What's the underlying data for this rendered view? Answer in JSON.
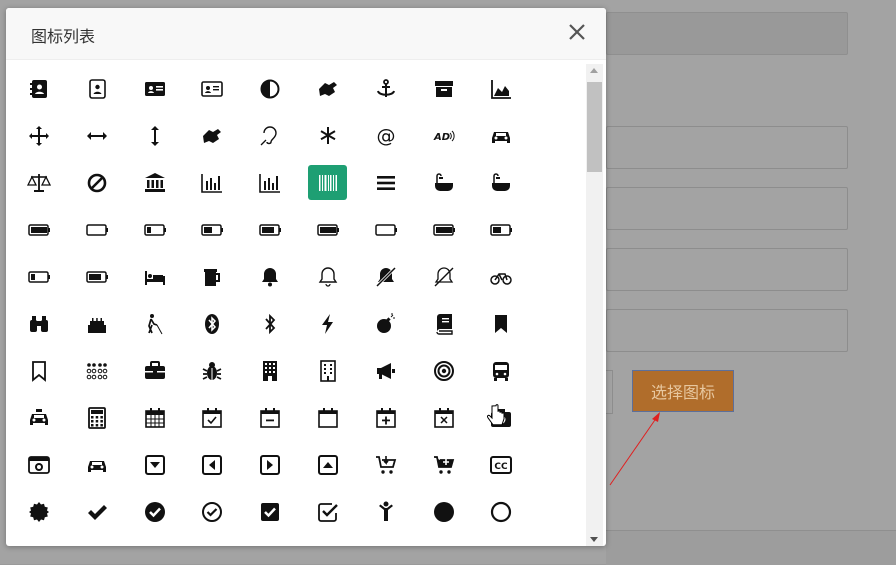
{
  "modal": {
    "title": "图标列表",
    "selected_index": 23
  },
  "icons": [
    "address-book",
    "address-book-o",
    "address-card",
    "address-card-o",
    "adjust",
    "american-sign-language-interpreting",
    "anchor",
    "archive",
    "area-chart",
    "arrows",
    "arrows-h",
    "arrows-v",
    "asl-interpreting",
    "assistive-listening-systems",
    "asterisk",
    "at",
    "audio-description",
    "automobile",
    "balance-scale",
    "ban",
    "bank",
    "bar-chart",
    "bar-chart-o",
    "barcode",
    "bars",
    "bath",
    "bathtub",
    "battery",
    "battery-0",
    "battery-1",
    "battery-2",
    "battery-3",
    "battery-4",
    "battery-empty",
    "battery-full",
    "battery-half",
    "battery-quarter",
    "battery-three-quarters",
    "bed",
    "beer",
    "bell",
    "bell-o",
    "bell-slash",
    "bell-slash-o",
    "bicycle",
    "binoculars",
    "birthday-cake",
    "blind",
    "bluetooth",
    "bluetooth-b",
    "bolt",
    "bomb",
    "book",
    "bookmark",
    "bookmark-o",
    "braille",
    "briefcase",
    "bug",
    "building",
    "building-o",
    "bullhorn",
    "bullseye",
    "bus",
    "cab",
    "calculator",
    "calendar",
    "calendar-check-o",
    "calendar-minus-o",
    "calendar-o",
    "calendar-plus-o",
    "calendar-times-o",
    "camera",
    "camera-retro",
    "car",
    "caret-square-o-down",
    "caret-square-o-left",
    "caret-square-o-right",
    "caret-square-o-up",
    "cart-arrow-down",
    "cart-plus",
    "cc",
    "certificate",
    "check",
    "check-circle",
    "check-circle-o",
    "check-square",
    "check-square-o",
    "child",
    "circle",
    "circle-o"
  ],
  "background": {
    "choose_button_label": "选择图标"
  },
  "colors": {
    "selected": "#1e9f73",
    "choose_button": "#b06d2b",
    "arrow": "#e02020"
  }
}
